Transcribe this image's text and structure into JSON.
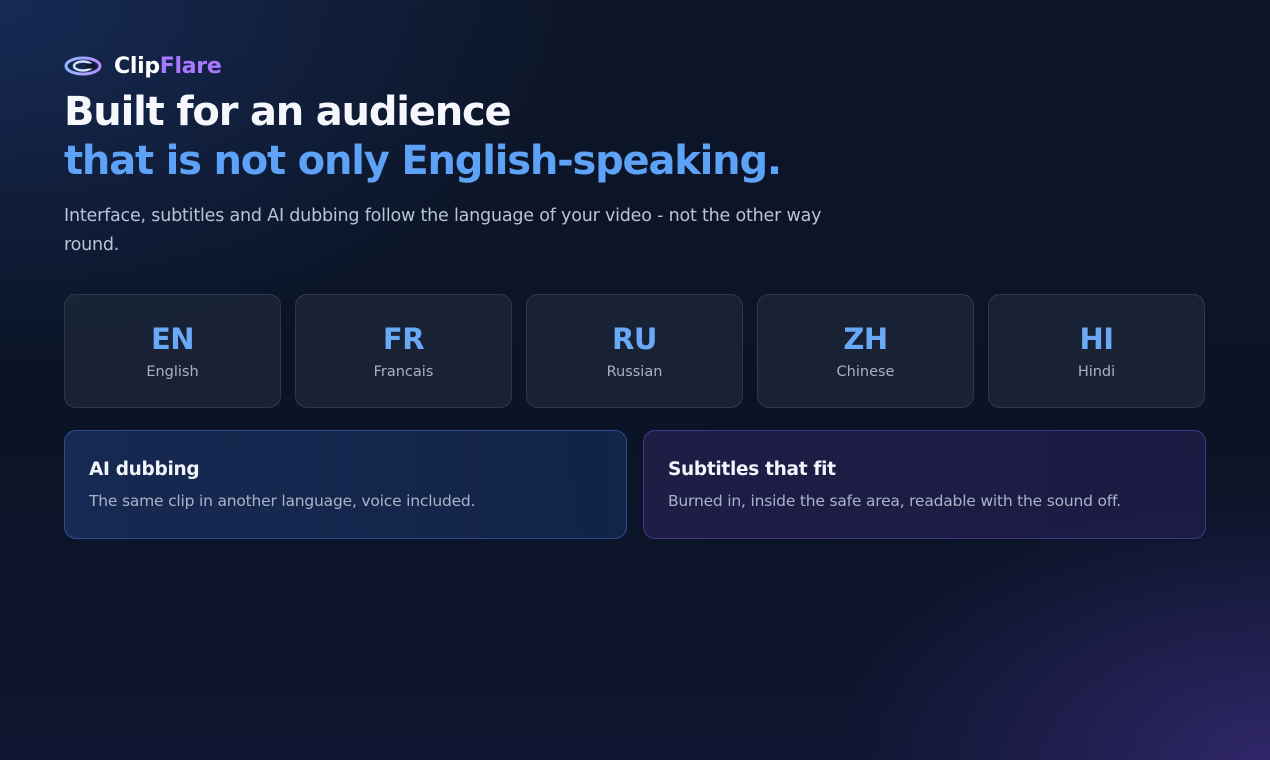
{
  "brand": {
    "name_part1": "Clip",
    "name_part2": "Flare",
    "icon": "clipflare-logo-icon",
    "colors": {
      "primary": "#ffffff",
      "accent": "#a878ff"
    }
  },
  "hero": {
    "title_line1": "Built for an audience",
    "title_line2": "that is not only English-speaking.",
    "subtitle": "Interface, subtitles and AI dubbing follow the language of your video - not the other way round."
  },
  "languages": [
    {
      "code": "EN",
      "name": "English"
    },
    {
      "code": "FR",
      "name": "Francais"
    },
    {
      "code": "RU",
      "name": "Russian"
    },
    {
      "code": "ZH",
      "name": "Chinese"
    },
    {
      "code": "HI",
      "name": "Hindi"
    }
  ],
  "features": [
    {
      "title": "AI dubbing",
      "description": "The same clip in another language, voice included."
    },
    {
      "title": "Subtitles that fit",
      "description": "Burned in, inside the safe area, readable with the sound off."
    }
  ],
  "colors": {
    "highlight": "#5ea2f7",
    "code": "#6aa9f7",
    "background": "#0b1426"
  }
}
